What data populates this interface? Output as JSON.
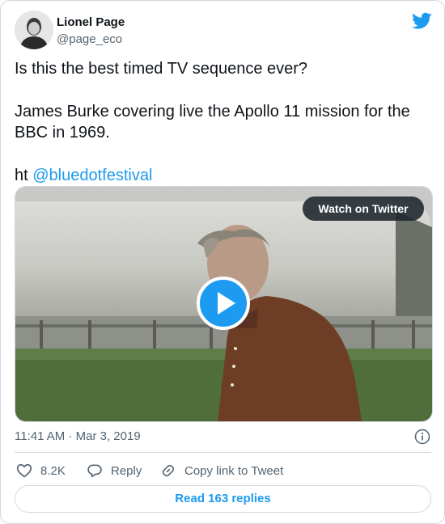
{
  "author": {
    "name": "Lionel Page",
    "handle": "@page_eco",
    "avatar_icon": "avatar-portrait"
  },
  "tweet": {
    "line1": "Is this the best timed TV sequence ever?",
    "line2": "James Burke covering live the Apollo 11 mission for the BBC in 1969.",
    "ht_prefix": "ht ",
    "mention": "@bluedotfestival"
  },
  "media": {
    "watch_label": "Watch on Twitter",
    "play_icon": "play-icon"
  },
  "meta": {
    "time": "11:41 AM",
    "separator": " · ",
    "date": "Mar 3, 2019"
  },
  "actions": {
    "likes_count": "8.2K",
    "reply_label": "Reply",
    "copy_label": "Copy link to Tweet"
  },
  "replies_button": "Read 163 replies",
  "colors": {
    "accent": "#1d9bf0",
    "text": "#0f1419",
    "secondary": "#536471",
    "border": "#cfd9de"
  }
}
